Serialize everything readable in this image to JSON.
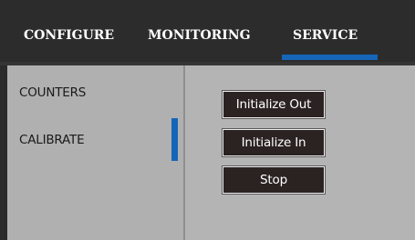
{
  "header": {
    "tabs": [
      {
        "label": "CONFIGURE"
      },
      {
        "label": "MONITORING"
      },
      {
        "label": "SERVICE",
        "active": true
      }
    ]
  },
  "sidebar": {
    "items": [
      {
        "label": "COUNTERS"
      },
      {
        "label": "CALIBRATE",
        "active": true
      }
    ]
  },
  "main": {
    "buttons": [
      {
        "label": "Initialize Out"
      },
      {
        "label": "Initialize In"
      },
      {
        "label": "Stop"
      }
    ]
  },
  "colors": {
    "accent": "#1565b8",
    "topbar": "#2c2c2c",
    "panel": "#b4b4b4",
    "button": "#2b2322"
  }
}
